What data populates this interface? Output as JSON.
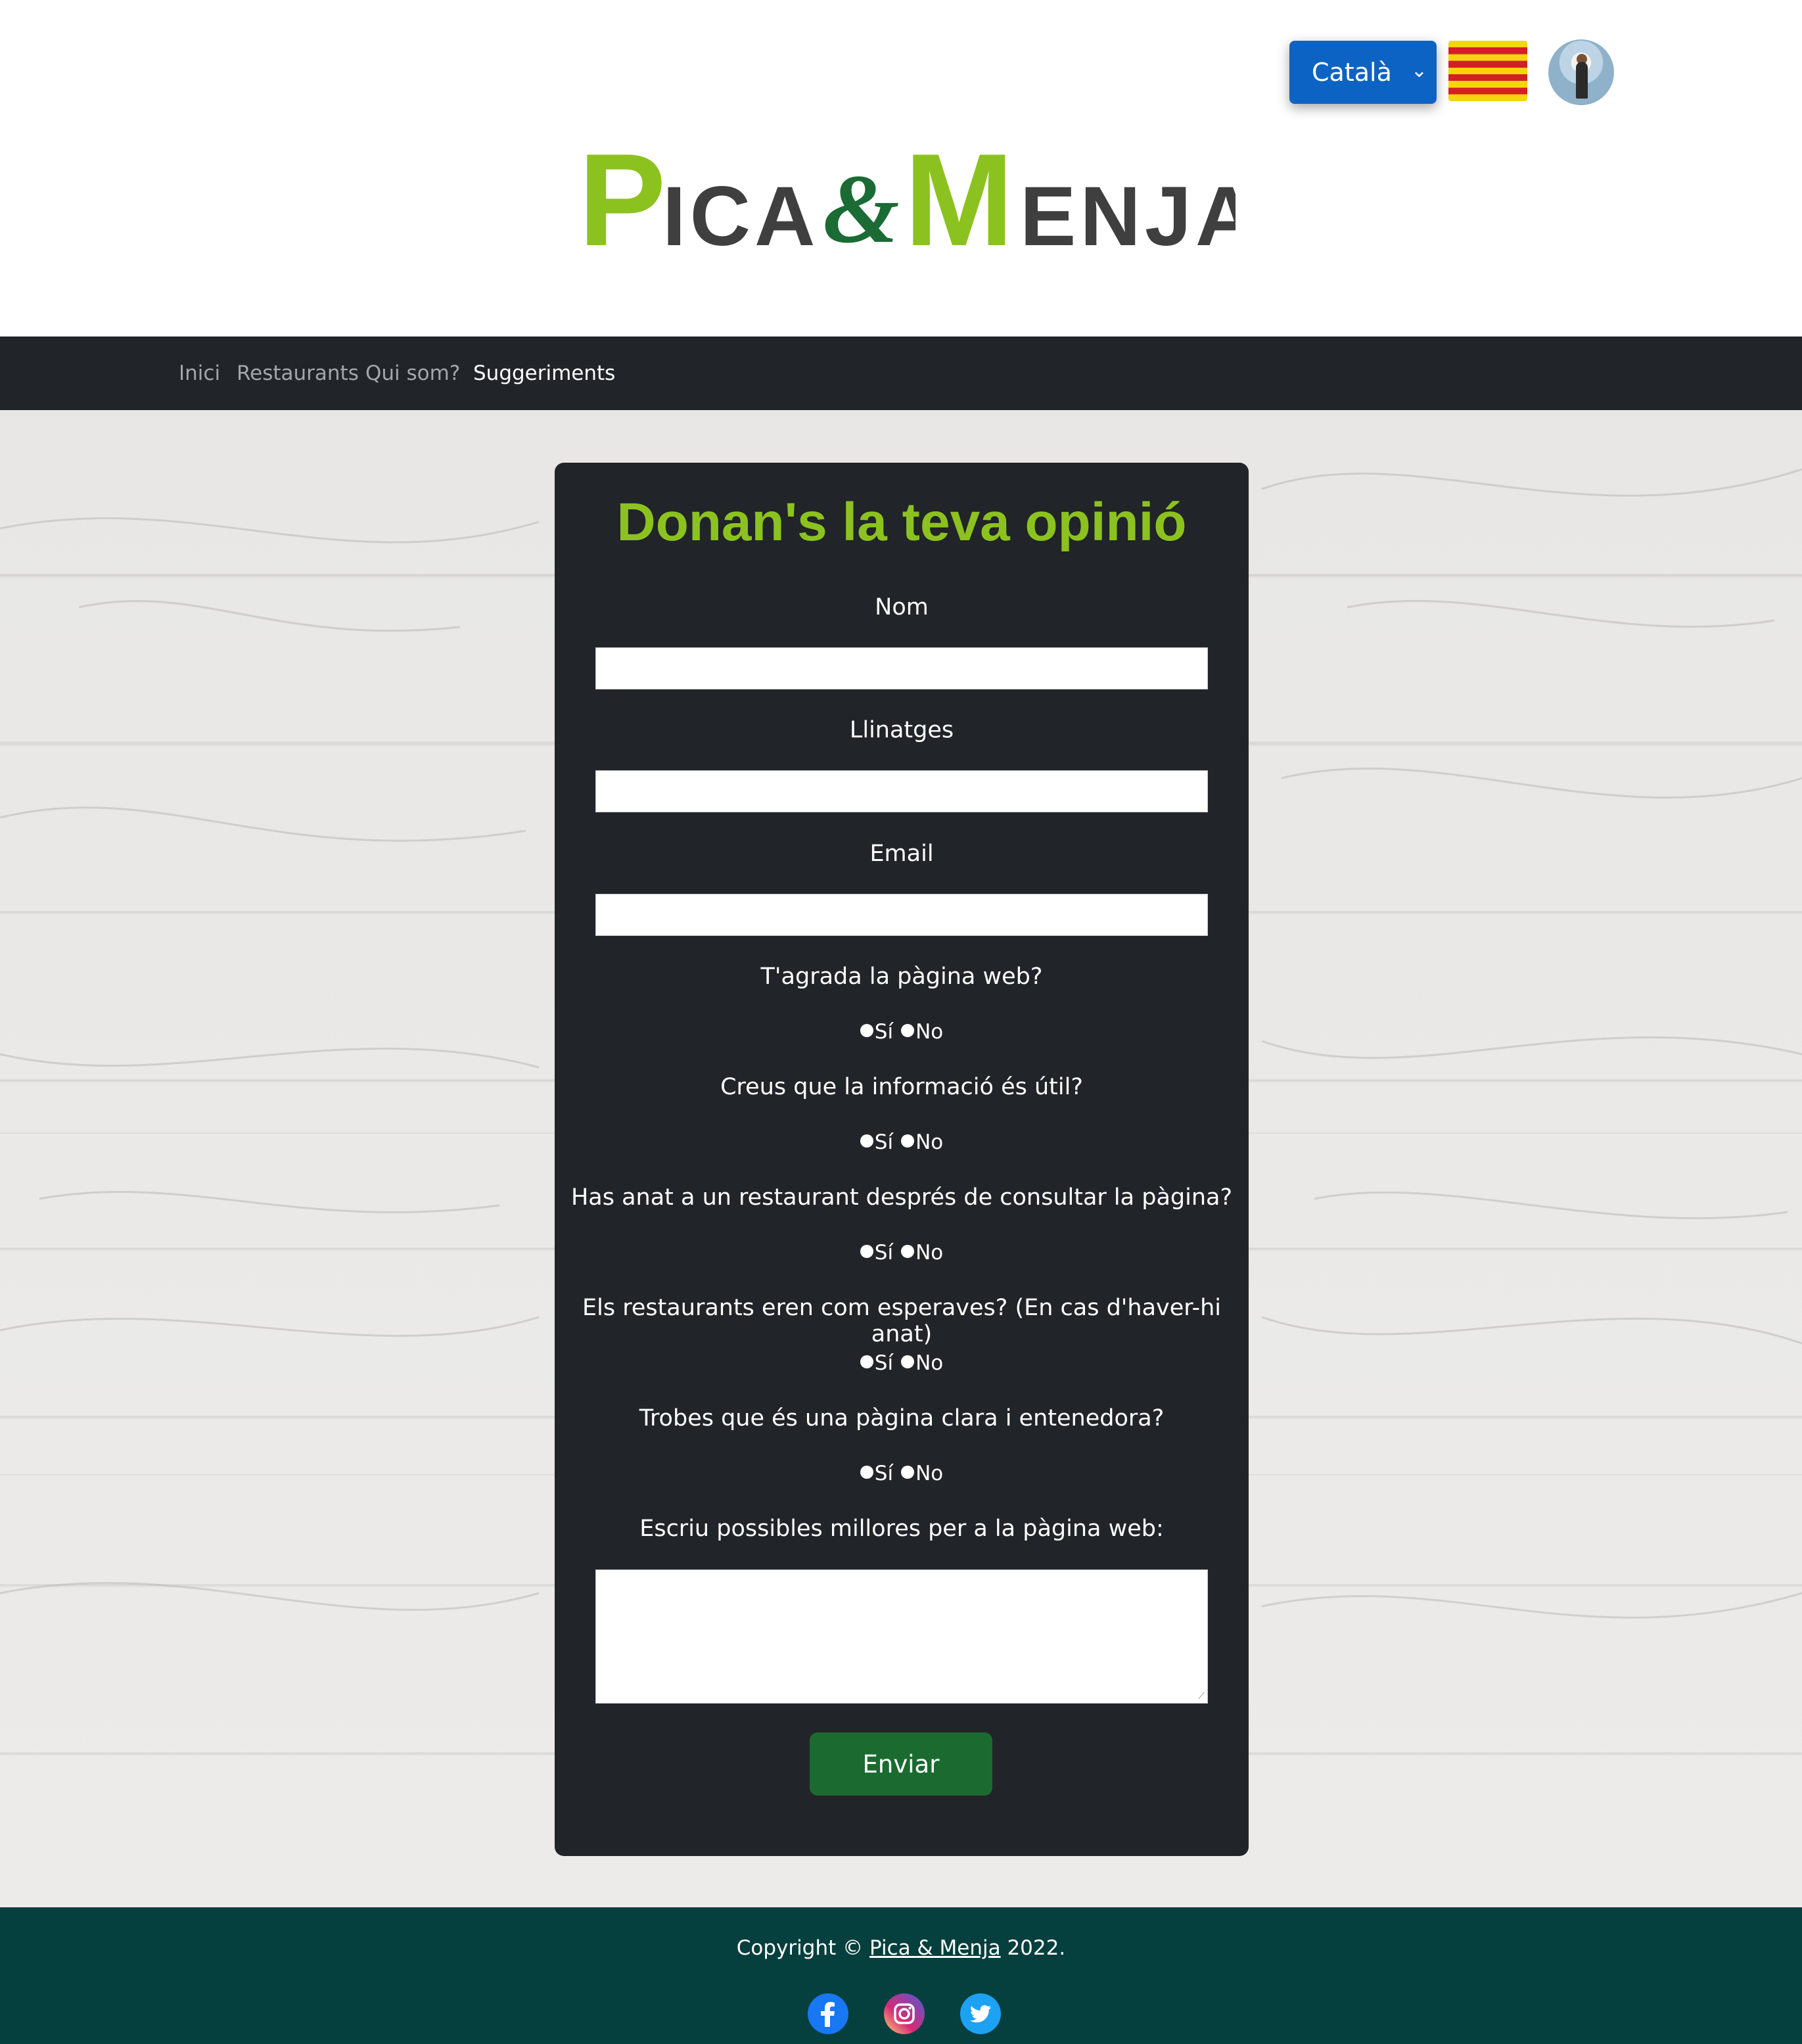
{
  "header": {
    "language_select": {
      "value": "Català"
    },
    "logo": {
      "text_p": "P",
      "text_ica": "ICA",
      "text_amp": "&",
      "text_m": "M",
      "text_enja": "ENJA"
    }
  },
  "nav": {
    "items": [
      "Inici",
      "Restaurants",
      "Qui som?",
      "Suggeriments"
    ]
  },
  "form": {
    "title": "Donan's la teva opinió",
    "fields": [
      {
        "label": "Nom",
        "value": ""
      },
      {
        "label": "Llinatges",
        "value": ""
      },
      {
        "label": "Email",
        "value": ""
      }
    ],
    "questions": [
      "T'agrada la pàgina web?",
      "Creus que la informació és útil?",
      "Has anat a un restaurant després de consultar la pàgina?",
      "Els restaurants eren com esperaves? (En cas d'haver-hi anat)",
      "Trobes que és una pàgina clara i entenedora?"
    ],
    "yes_label": "Sí",
    "no_label": "No",
    "improvements_label": "Escriu possibles millores per a la pàgina web:",
    "improvements_value": "",
    "submit_label": "Enviar"
  },
  "footer": {
    "copyright_prefix": "Copyright ©",
    "brand_link": "Pica & Menja",
    "year_suffix": "2022.",
    "social": [
      "facebook-icon",
      "instagram-icon",
      "twitter-icon"
    ]
  },
  "colors": {
    "accent_green": "#8cc21f",
    "button_green": "#1b6b30",
    "nav_bg": "#212428",
    "footer_bg": "#053f3e",
    "select_blue": "#0d63c4"
  }
}
